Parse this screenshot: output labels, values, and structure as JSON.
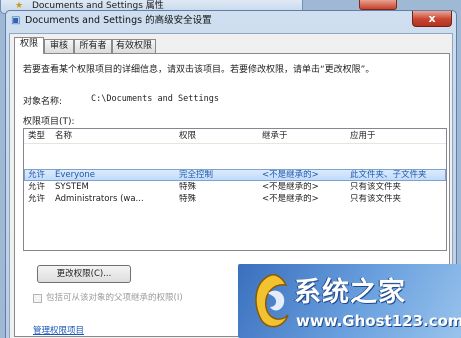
{
  "background_window": {
    "title": "Documents and Settings 属性"
  },
  "dialog": {
    "title": "Documents and Settings 的高级安全设置",
    "close_label": "x"
  },
  "tabs": [
    {
      "label": "权限",
      "active": true
    },
    {
      "label": "审核",
      "active": false
    },
    {
      "label": "所有者",
      "active": false
    },
    {
      "label": "有效权限",
      "active": false
    }
  ],
  "panel": {
    "description": "若要查看某个权限项目的详细信息，请双击该项目。若要修改权限，请单击“更改权限”。",
    "object_name_label": "对象名称:",
    "object_name_value": "C:\\Documents and Settings",
    "permission_entries_label": "权限项目(T):"
  },
  "listview": {
    "columns": [
      "类型",
      "名称",
      "权限",
      "继承于",
      "应用于"
    ],
    "rows": [
      {
        "type": "允许",
        "name": "Everyone",
        "permission": "完全控制",
        "inherited_from": "<不是继承的>",
        "applies_to": "此文件夹、子文件夹",
        "selected": true
      },
      {
        "type": "允许",
        "name": "SYSTEM",
        "permission": "特殊",
        "inherited_from": "<不是继承的>",
        "applies_to": "只有该文件夹",
        "selected": false
      },
      {
        "type": "允许",
        "name": "Administrators (wa...",
        "permission": "特殊",
        "inherited_from": "<不是继承的>",
        "applies_to": "只有该文件夹",
        "selected": false
      }
    ]
  },
  "buttons": {
    "change_permissions": "更改权限(C)..."
  },
  "inherit_checkbox": {
    "label": "包括可从该对象的父项继承的权限(I)",
    "checked": false,
    "enabled": false
  },
  "link": {
    "manage_entries": "管理权限项目"
  },
  "watermark": {
    "title": "系统之家",
    "url": "www.Ghost123.com"
  },
  "colors": {
    "selection_text": "#1f58a9",
    "link": "#1c56b8",
    "close_button": "#c8442f",
    "watermark_blue": "#3a6fbe"
  }
}
